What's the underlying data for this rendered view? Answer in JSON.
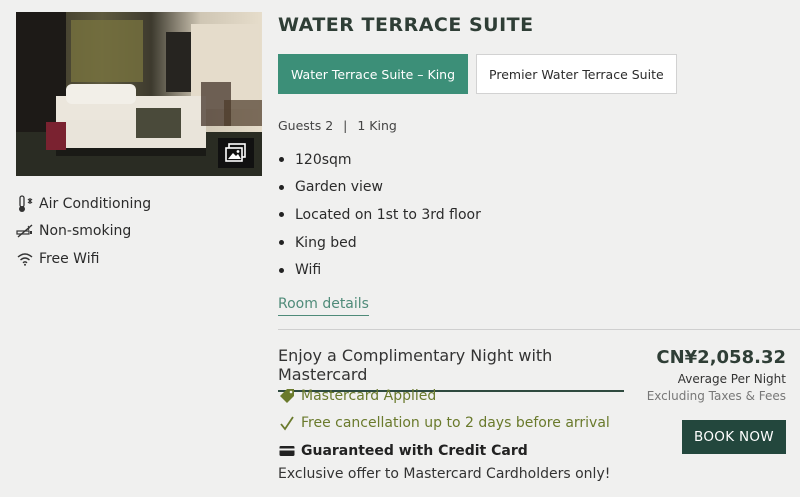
{
  "room": {
    "title": "WATER TERRACE SUITE",
    "photo_alt": "room-photo",
    "gallery_icon": "gallery-icon",
    "tabs": [
      {
        "label": "Water Terrace Suite – King",
        "active": true
      },
      {
        "label": "Premier Water Terrace Suite",
        "active": false
      }
    ],
    "guests": "Guests 2",
    "bed": "1 King",
    "separator": "|",
    "features": [
      "120sqm",
      "Garden view",
      "Located on 1st to 3rd floor",
      "King bed",
      "Wifi"
    ],
    "details_link": "Room details"
  },
  "amenities": [
    {
      "icon": "thermometer-snowflake-icon",
      "label": "Air Conditioning"
    },
    {
      "icon": "no-smoking-icon",
      "label": "Non-smoking"
    },
    {
      "icon": "wifi-icon",
      "label": "Free Wifi"
    }
  ],
  "offer": {
    "title": "Enjoy a Complimentary Night with Mastercard",
    "perks": [
      {
        "icon": "tag-icon",
        "label": "Mastercard Applied"
      },
      {
        "icon": "checkmark-icon",
        "label": "Free cancellation up to 2 days before arrival"
      },
      {
        "icon": "credit-card-icon",
        "label": "Guaranteed with Credit Card"
      }
    ],
    "exclusive": "Exclusive offer to Mastercard Cardholders only!"
  },
  "price": {
    "amount": "CN¥2,058.32",
    "per_night": "Average Per Night",
    "taxes": "Excluding Taxes & Fees",
    "book_label": "BOOK NOW"
  },
  "colors": {
    "accent": "#3c8f78",
    "dark_green": "#23473d",
    "perk_green": "#6a7a2c",
    "background": "#f0f0ef"
  }
}
